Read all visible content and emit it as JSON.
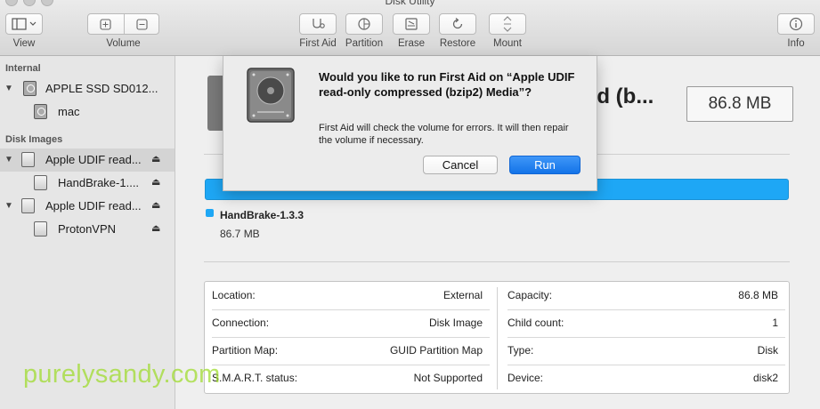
{
  "window": {
    "title": "Disk Utility"
  },
  "toolbar": {
    "view_label": "View",
    "volume_label": "Volume",
    "first_aid_label": "First Aid",
    "partition_label": "Partition",
    "erase_label": "Erase",
    "restore_label": "Restore",
    "mount_label": "Mount",
    "info_label": "Info"
  },
  "sidebar": {
    "internal_header": "Internal",
    "disk_images_header": "Disk Images",
    "items": [
      {
        "label": "APPLE SSD SD012...",
        "icon": "internal-disk-icon"
      },
      {
        "label": "mac",
        "icon": "volume-icon"
      },
      {
        "label": "Apple UDIF read...",
        "icon": "disk-image-icon",
        "eject": "⏏"
      },
      {
        "label": "HandBrake-1....",
        "icon": "volume-icon",
        "eject": "⏏"
      },
      {
        "label": "Apple UDIF read...",
        "icon": "disk-image-icon",
        "eject": "⏏"
      },
      {
        "label": "ProtonVPN",
        "icon": "volume-icon",
        "eject": "⏏"
      }
    ]
  },
  "main": {
    "title_fragment": "ed (b...",
    "size": "86.8 MB",
    "legend": {
      "name": "HandBrake-1.3.3",
      "size": "86.7 MB",
      "color": "#1ea7f5"
    },
    "info": {
      "left": [
        {
          "key": "Location:",
          "value": "External"
        },
        {
          "key": "Connection:",
          "value": "Disk Image"
        },
        {
          "key": "Partition Map:",
          "value": "GUID Partition Map"
        },
        {
          "key": "S.M.A.R.T. status:",
          "value": "Not Supported"
        }
      ],
      "right": [
        {
          "key": "Capacity:",
          "value": "86.8 MB"
        },
        {
          "key": "Child count:",
          "value": "1"
        },
        {
          "key": "Type:",
          "value": "Disk"
        },
        {
          "key": "Device:",
          "value": "disk2"
        }
      ]
    }
  },
  "dialog": {
    "title": "Would you like to run First Aid on “Apple UDIF read-only compressed (bzip2) Media”?",
    "message": "First Aid will check the volume for errors. It will then repair the volume if necessary.",
    "cancel_label": "Cancel",
    "run_label": "Run",
    "accent": "#1e7cf0"
  },
  "watermark": "purelysandy.com"
}
